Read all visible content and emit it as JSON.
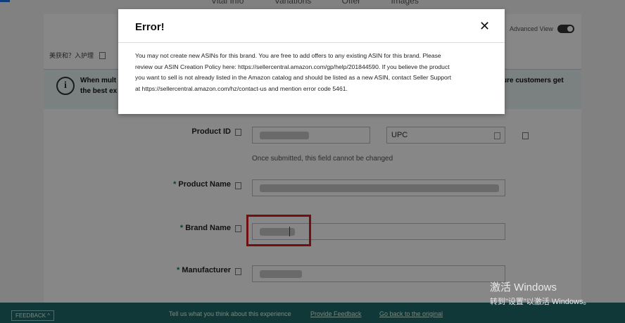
{
  "topnav": [
    "Vital Info",
    "Variations",
    "Offer",
    "Images"
  ],
  "advanced_view": {
    "label": "Advanced View"
  },
  "cn_row": {
    "label": "美获和？入护理"
  },
  "banner": {
    "line1": "When mult",
    "line2": "the best ex",
    "line3": "ure customers get"
  },
  "form": {
    "product_id_label": "Product ID",
    "product_id_type": "UPC",
    "product_id_hint": "Once submitted, this field cannot be changed",
    "product_name_label": "Product Name",
    "brand_name_label": "Brand Name",
    "manufacturer_label": "Manufacturer",
    "required_mark": "*"
  },
  "footer": {
    "feedback_button": "FEEDBACK ^",
    "prompt": "Tell us what you think about this experience",
    "provide_feedback": "Provide Feedback",
    "go_back": "Go back to the original"
  },
  "modal": {
    "title": "Error!",
    "close": "✕",
    "line1": "You may not create new ASINs for this brand. You are free to add offers to any existing ASIN for this brand. Please",
    "line2": "review our ASIN Creation Policy here: https://sellercentral.amazon.com/gp/help/201844590. If you believe the product",
    "line3": "you want to sell is not already listed in the Amazon catalog and should be listed as a new ASIN, contact Seller Support",
    "line4": "at https://sellercentral.amazon.com/hz/contact-us and mention error code 5461."
  },
  "watermark": {
    "line1": "激活 Windows",
    "line2": "转到\"设置\"以激活 Windows。"
  },
  "colors": {
    "accent": "#1f6b6b",
    "highlight": "#d71e1e",
    "required": "#0a7d6b"
  }
}
